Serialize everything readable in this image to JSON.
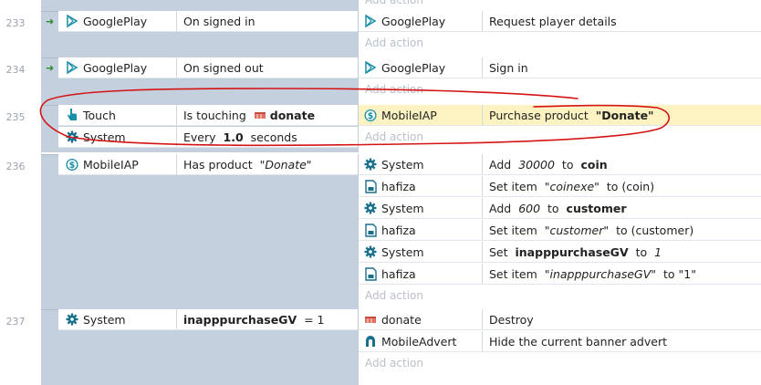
{
  "add_action": "Add action",
  "events": [
    {
      "line": "233",
      "conditions": [
        {
          "object": "GooglePlay",
          "icon": "play-icon",
          "trigger": true,
          "parts": [
            {
              "t": "On signed in"
            }
          ]
        }
      ],
      "actions": [
        {
          "object": "GooglePlay",
          "icon": "play-icon",
          "parts": [
            {
              "t": "Request player details"
            }
          ]
        }
      ]
    },
    {
      "line": "234",
      "conditions": [
        {
          "object": "GooglePlay",
          "icon": "play-icon",
          "trigger": true,
          "parts": [
            {
              "t": "On signed out"
            }
          ]
        }
      ],
      "actions": [
        {
          "object": "GooglePlay",
          "icon": "play-icon",
          "parts": [
            {
              "t": "Sign in"
            }
          ]
        }
      ]
    },
    {
      "line": "235",
      "conditions": [
        {
          "object": "Touch",
          "icon": "touch-icon",
          "parts": [
            {
              "t": "Is touching "
            },
            {
              "t": "donate",
              "b": true,
              "sprite": true
            }
          ]
        },
        {
          "object": "System",
          "icon": "gear-icon",
          "parts": [
            {
              "t": "Every "
            },
            {
              "t": "1.0",
              "b": true
            },
            {
              "t": " seconds"
            }
          ]
        }
      ],
      "actions": [
        {
          "object": "MobileIAP",
          "icon": "dollar-icon",
          "highlight": true,
          "parts": [
            {
              "t": "Purchase product "
            },
            {
              "t": "\"Donate\"",
              "b": true
            }
          ]
        }
      ]
    },
    {
      "line": "236",
      "conditions": [
        {
          "object": "MobileIAP",
          "icon": "dollar-icon",
          "parts": [
            {
              "t": "Has product "
            },
            {
              "t": "\"Donate\"",
              "i": true
            }
          ]
        }
      ],
      "actions": [
        {
          "object": "System",
          "icon": "gear-icon",
          "parts": [
            {
              "t": "Add "
            },
            {
              "t": "30000",
              "i": true
            },
            {
              "t": " to "
            },
            {
              "t": "coin",
              "b": true
            }
          ]
        },
        {
          "object": "hafiza",
          "icon": "storage-icon",
          "parts": [
            {
              "t": "Set item "
            },
            {
              "t": "\"coinexe\"",
              "i": true
            },
            {
              "t": " to (coin)"
            }
          ]
        },
        {
          "object": "System",
          "icon": "gear-icon",
          "parts": [
            {
              "t": "Add "
            },
            {
              "t": "600",
              "i": true
            },
            {
              "t": " to "
            },
            {
              "t": "customer",
              "b": true
            }
          ]
        },
        {
          "object": "hafiza",
          "icon": "storage-icon",
          "parts": [
            {
              "t": "Set item "
            },
            {
              "t": "\"customer\"",
              "i": true
            },
            {
              "t": " to (customer)"
            }
          ]
        },
        {
          "object": "System",
          "icon": "gear-icon",
          "parts": [
            {
              "t": "Set "
            },
            {
              "t": "inapppurchaseGV",
              "b": true
            },
            {
              "t": " to "
            },
            {
              "t": "1",
              "i": true
            }
          ]
        },
        {
          "object": "hafiza",
          "icon": "storage-icon",
          "parts": [
            {
              "t": "Set item "
            },
            {
              "t": "\"inapppurchaseGV\"",
              "i": true
            },
            {
              "t": " to \"1\""
            }
          ]
        }
      ]
    },
    {
      "line": "237",
      "conditions": [
        {
          "object": "System",
          "icon": "gear-icon",
          "parts": [
            {
              "t": "inapppurchaseGV",
              "b": true
            },
            {
              "t": " = 1"
            }
          ]
        }
      ],
      "actions": [
        {
          "object": "donate",
          "icon": "sprite-icon",
          "parts": [
            {
              "t": "Destroy"
            }
          ]
        },
        {
          "object": "MobileAdvert",
          "icon": "advert-icon",
          "parts": [
            {
              "t": "Hide the current banner advert"
            }
          ]
        }
      ]
    }
  ],
  "colors": {
    "accent": "#1a8fa8",
    "highlight": "#fdf3c2",
    "event_bg": "#c4d0de",
    "annotation": "#d41414"
  }
}
